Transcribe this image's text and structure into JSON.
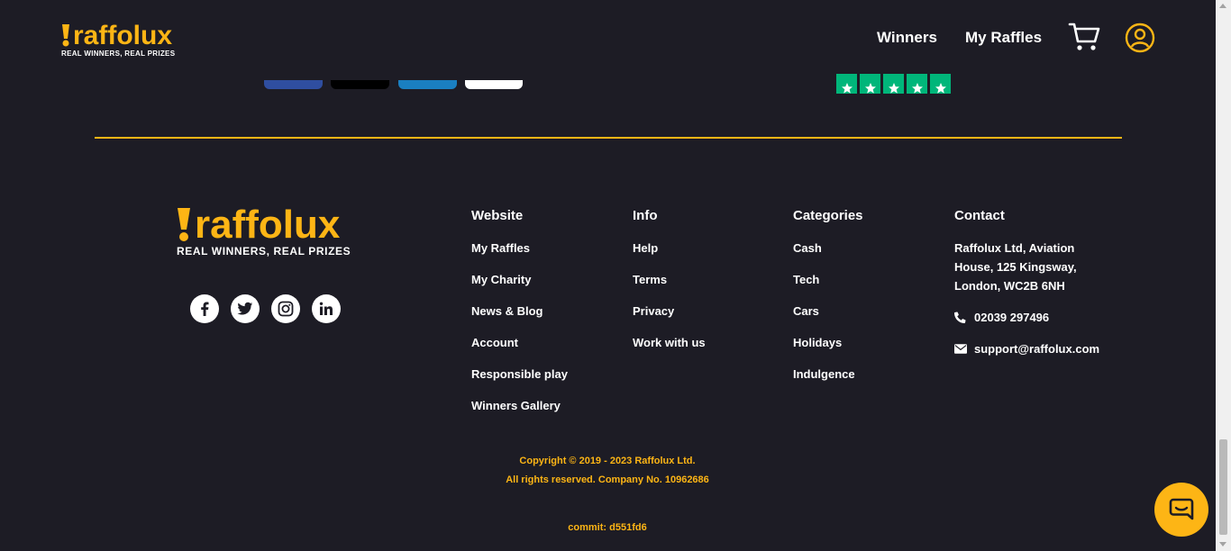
{
  "header": {
    "logo_word": "raffolux",
    "logo_tagline": "REAL WINNERS, REAL PRIZES",
    "nav": [
      {
        "label": "Winners"
      },
      {
        "label": "My Raffles"
      }
    ]
  },
  "footer": {
    "logo_word": "raffolux",
    "logo_tagline": "REAL WINNERS, REAL PRIZES",
    "columns": [
      {
        "title": "Website",
        "links": [
          "My Raffles",
          "My Charity",
          "News & Blog",
          "Account",
          "Responsible play",
          "Winners Gallery"
        ]
      },
      {
        "title": "Info",
        "links": [
          "Help",
          "Terms",
          "Privacy",
          "Work with us"
        ]
      },
      {
        "title": "Categories",
        "links": [
          "Cash",
          "Tech",
          "Cars",
          "Holidays",
          "Indulgence"
        ]
      }
    ],
    "contact": {
      "title": "Contact",
      "address": [
        "Raffolux Ltd, Aviation",
        "House, 125 Kingsway,",
        "London, WC2B 6NH"
      ],
      "phone": "02039 297496",
      "email": "support@raffolux.com"
    },
    "copyright_line1": "Copyright © 2019 - 2023 Raffolux Ltd.",
    "copyright_line2": "All rights reserved. Company No. 10962686",
    "commit": "commit: d551fd6"
  },
  "colors": {
    "background": "#1d1c25",
    "accent": "#fdb515",
    "trustpilot": "#00b67a"
  },
  "icons": [
    "cart-icon",
    "user-icon",
    "facebook-icon",
    "twitter-icon",
    "instagram-icon",
    "linkedin-icon",
    "phone-icon",
    "envelope-icon",
    "chat-icon"
  ]
}
